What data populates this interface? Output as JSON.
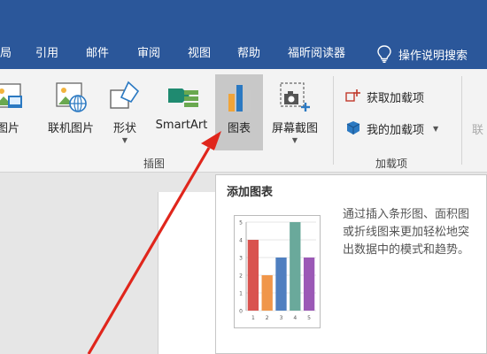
{
  "menu": {
    "tabs": [
      "局",
      "引用",
      "邮件",
      "审阅",
      "视图",
      "帮助",
      "福昕阅读器"
    ],
    "tell_me": "操作说明搜索"
  },
  "ribbon": {
    "illustrations": {
      "group_label": "插图",
      "buttons": {
        "pictures": "图片",
        "online_pictures": "联机图片",
        "shapes": "形状",
        "smartart": "SmartArt",
        "chart": "图表",
        "screenshot": "屏幕截图"
      }
    },
    "addins": {
      "group_label": "加载项",
      "get_addins": "获取加载项",
      "my_addins": "我的加载项"
    },
    "cut_off": "联"
  },
  "tooltip": {
    "title": "添加图表",
    "description": "通过插入条形图、面积图或折线图来更加轻松地突出数据中的模式和趋势。",
    "preview_chart": {
      "type": "bar",
      "categories": [
        "1",
        "2",
        "3",
        "4",
        "5"
      ],
      "values": [
        4,
        2,
        3,
        5,
        3
      ],
      "ylim": [
        0,
        5
      ],
      "yticks": [
        "0",
        "1",
        "2",
        "3",
        "4",
        "5"
      ],
      "colors": [
        "#d9534f",
        "#f0964a",
        "#4f7fc0",
        "#6aa99b",
        "#9b59b6"
      ]
    }
  }
}
